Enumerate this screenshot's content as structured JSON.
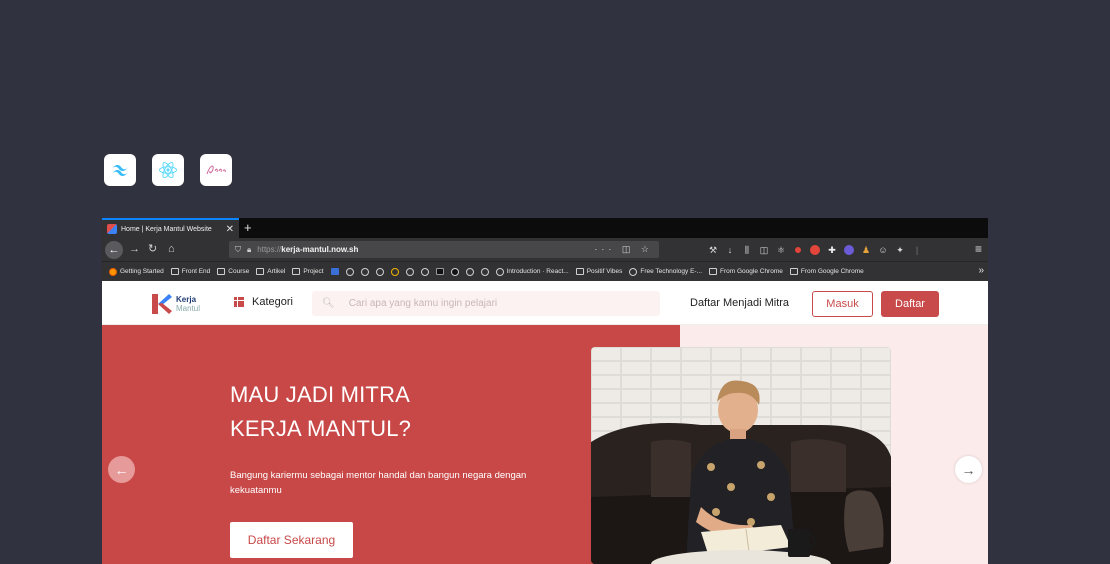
{
  "badges": [
    {
      "name": "tailwind-logo-icon"
    },
    {
      "name": "react-logo-icon"
    },
    {
      "name": "sass-logo-icon"
    }
  ],
  "browser": {
    "tab_title": "Home | Kerja Mantul Website",
    "url_protocol": "https://",
    "url_host": "kerja-mantul.now.sh",
    "bookmarks": [
      "Getting Started",
      "Front End",
      "Course",
      "Artikel",
      "Project",
      "Introduction · React...",
      "Positif Vibes",
      "Free Technology E-...",
      "From Google Chrome",
      "From Google Chrome"
    ]
  },
  "header": {
    "logo_line1": "Kerja",
    "logo_line2": "Mantul",
    "kategori_label": "Kategori",
    "search_placeholder": "Cari apa yang kamu ingin pelajari",
    "mitra_link": "Daftar Menjadi Mitra",
    "masuk_label": "Masuk",
    "daftar_label": "Daftar"
  },
  "hero": {
    "title_line1": "MAU JADI MITRA",
    "title_line2": "KERJA MANTUL?",
    "description": "Bangung kariermu sebagai mentor handal dan bangun negara dengan kekuatanmu",
    "cta_label": "Daftar Sekarang"
  },
  "colors": {
    "background": "#30323f",
    "brand_red": "#c84848",
    "brand_pink": "#fcebeb"
  }
}
